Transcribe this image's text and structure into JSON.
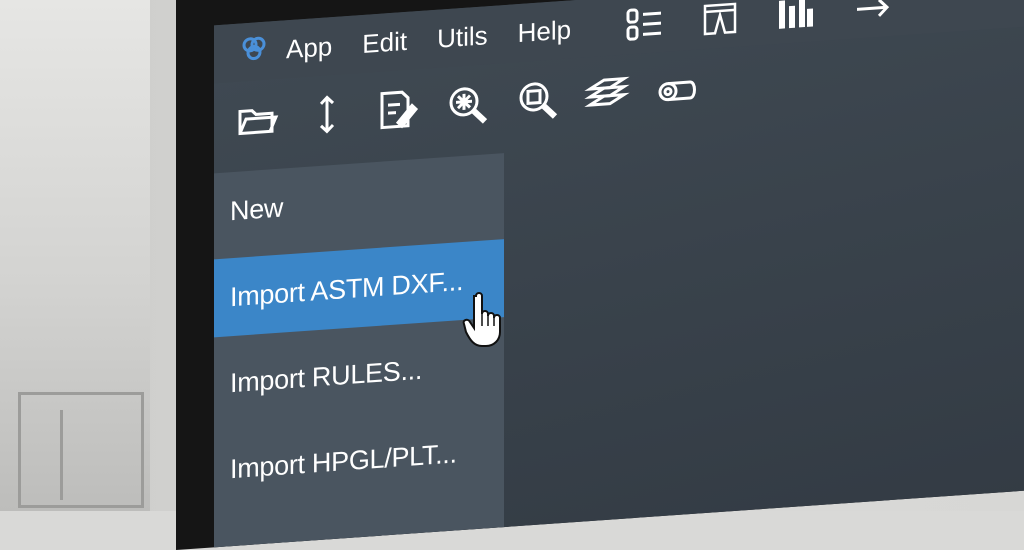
{
  "menubar": {
    "logo_icon": "app-logo-icon",
    "items": [
      "App",
      "Edit",
      "Utils",
      "Help"
    ],
    "icons": [
      "chain-list-icon",
      "pants-pattern-icon",
      "grading-icon",
      "arrow-icon"
    ]
  },
  "toolbar": {
    "icons": [
      "open-folder-icon",
      "resize-vertical-icon",
      "edit-document-icon",
      "zoom-all-icon",
      "zoom-window-icon",
      "layers-icon",
      "roll-icon"
    ]
  },
  "panel": {
    "items": [
      {
        "label": "New",
        "active": false
      },
      {
        "label": "Import ASTM DXF...",
        "active": true
      },
      {
        "label": "Import RULES...",
        "active": false
      },
      {
        "label": "Import HPGL/PLT...",
        "active": false
      }
    ]
  },
  "colors": {
    "accent": "#3b86c8",
    "logo": "#4a90d9",
    "screen_bg": "#38414a",
    "panel_bg": "#4a5560"
  }
}
